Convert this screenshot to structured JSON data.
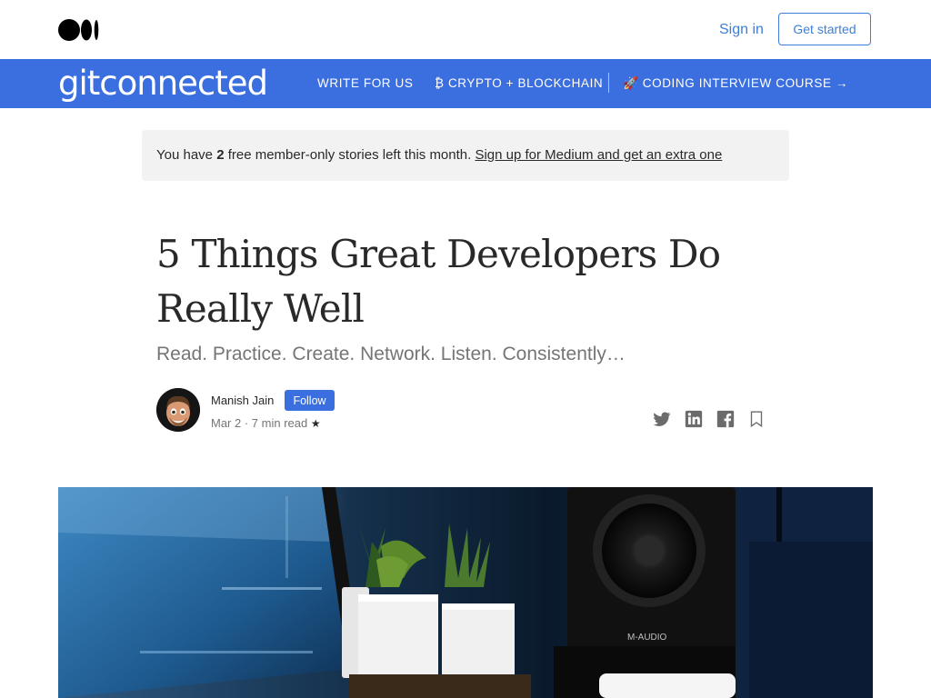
{
  "topbar": {
    "logo": "medium-logo",
    "signin_label": "Sign in",
    "getstarted_label": "Get started"
  },
  "publication": {
    "name": "gitconnected",
    "nav": [
      {
        "label": "WRITE FOR US"
      },
      {
        "label": "₿ CRYPTO + BLOCKCHAIN"
      },
      {
        "label": "🚀 CODING INTERVIEW COURSE →"
      }
    ],
    "color": "#3b6fe0"
  },
  "banner": {
    "prefix": "You have ",
    "count": "2",
    "suffix": " free member-only stories left this month. ",
    "link": "Sign up for Medium and get an extra one"
  },
  "article": {
    "title": "5 Things Great Developers Do Really Well",
    "subtitle": "Read. Practice. Create. Network. Listen. Consistently…",
    "author": "Manish Jain",
    "follow_label": "Follow",
    "date": "Mar 2",
    "read_time": "7 min read",
    "star": "★"
  },
  "share_icons": [
    "twitter-icon",
    "linkedin-icon",
    "facebook-icon",
    "bookmark-icon"
  ],
  "hero": {
    "speaker_label": "M-AUDIO"
  }
}
